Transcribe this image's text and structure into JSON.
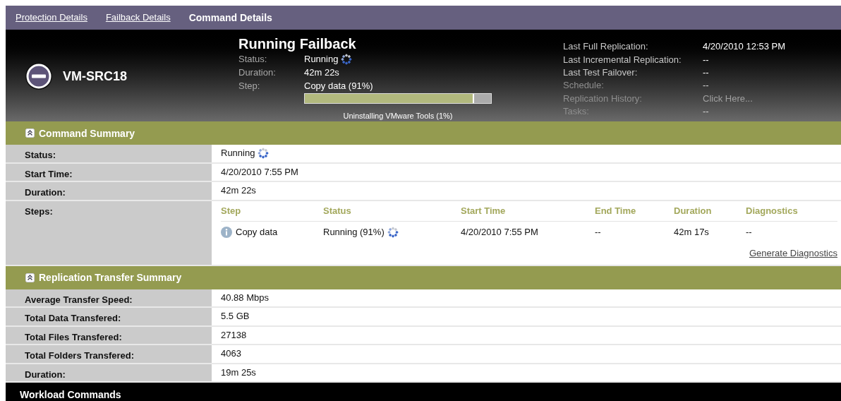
{
  "tabs": [
    {
      "label": "Protection Details",
      "selected": false
    },
    {
      "label": "Failback Details",
      "selected": false
    },
    {
      "label": "Command Details",
      "selected": true
    }
  ],
  "header": {
    "workload": "VM-SRC18",
    "title": "Running Failback",
    "fields": [
      {
        "label": "Status:",
        "value": "Running",
        "spinner": true
      },
      {
        "label": "Duration:",
        "value": "42m 22s",
        "spinner": false
      },
      {
        "label": "Step:",
        "value": "Copy data (91%)",
        "spinner": false
      }
    ],
    "progress": {
      "level": 0.91,
      "caption": "Uninstalling VMware Tools (1%)"
    },
    "info": [
      {
        "label": "Last Full Replication:",
        "value": "4/20/2010 12:53 PM",
        "disabled": false,
        "kind": "text"
      },
      {
        "label": "Last Incremental Replication:",
        "value": "--",
        "disabled": false,
        "kind": "text"
      },
      {
        "label": "Last Test Failover:",
        "value": "--",
        "disabled": false,
        "kind": "text"
      },
      {
        "label": "Schedule:",
        "value": "--",
        "disabled": true,
        "kind": "text"
      },
      {
        "label": "Replication History:",
        "value": "Click Here...",
        "disabled": true,
        "kind": "link"
      },
      {
        "label": "Tasks:",
        "value": "--",
        "disabled": true,
        "kind": "text"
      }
    ]
  },
  "command_summary": {
    "title": "Command Summary",
    "rows": [
      {
        "label": "Status:",
        "value": "Running",
        "spinner": true
      },
      {
        "label": "Start Time:",
        "value": "4/20/2010 7:55 PM",
        "spinner": false
      },
      {
        "label": "Duration:",
        "value": "42m 22s",
        "spinner": false
      }
    ],
    "steps": {
      "label": "Steps:",
      "columns": [
        "Step",
        "Status",
        "Start Time",
        "End Time",
        "Duration",
        "Diagnostics"
      ],
      "rows": [
        {
          "step": "Copy data",
          "status": "Running (91%)",
          "spinner": true,
          "start_time": "4/20/2010 7:55 PM",
          "end_time": "--",
          "duration": "42m 17s",
          "diagnostics": "--"
        }
      ],
      "link": "Generate Diagnostics"
    }
  },
  "replication_transfer_summary": {
    "title": "Replication Transfer Summary",
    "rows": [
      {
        "label": "Average Transfer Speed:",
        "value": "40.88 Mbps"
      },
      {
        "label": "Total Data Transfered:",
        "value": "5.5 GB"
      },
      {
        "label": "Total Files Transfered:",
        "value": "27138"
      },
      {
        "label": "Total Folders Transfered:",
        "value": "4063"
      },
      {
        "label": "Duration:",
        "value": "19m 25s"
      }
    ]
  },
  "footer": {
    "title": "Workload Commands"
  }
}
